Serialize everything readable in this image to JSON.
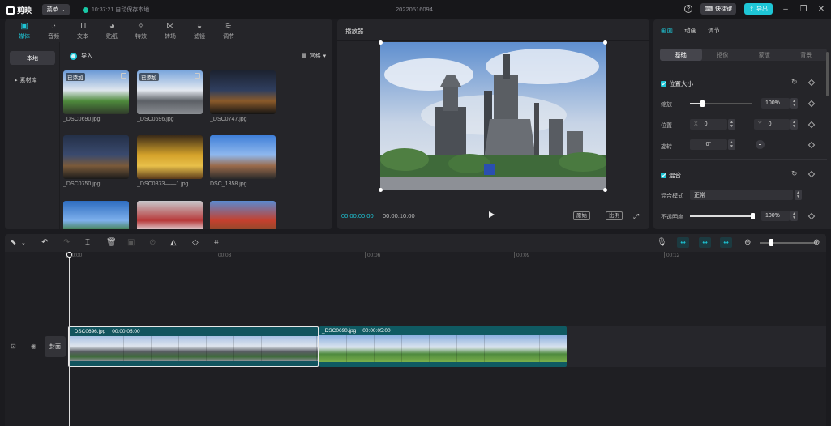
{
  "titlebar": {
    "app_name": "剪映",
    "menu_label": "菜单",
    "autosave_text": "10:37:21 自动保存本地",
    "project_title": "20220516094",
    "help_icon": "?",
    "shortcut_label": "快捷键",
    "export_label": "导出"
  },
  "media": {
    "tabs": [
      {
        "label": "媒体",
        "icon": "media-icon",
        "glyph": "▣",
        "active": true
      },
      {
        "label": "音频",
        "icon": "audio-icon",
        "glyph": "◔"
      },
      {
        "label": "文本",
        "icon": "text-icon",
        "glyph": "TI"
      },
      {
        "label": "贴纸",
        "icon": "sticker-icon",
        "glyph": "◕"
      },
      {
        "label": "特效",
        "icon": "effects-icon",
        "glyph": "✧"
      },
      {
        "label": "转场",
        "icon": "transition-icon",
        "glyph": "⋈"
      },
      {
        "label": "滤镜",
        "icon": "filter-icon",
        "glyph": "◒"
      },
      {
        "label": "调节",
        "icon": "adjust-icon",
        "glyph": "⚟"
      }
    ],
    "nav_local": "本地",
    "nav_library": "素材库",
    "import_label": "导入",
    "view_label": "宫格",
    "added_badge": "已添加",
    "items": [
      {
        "name": "_DSC0690.jpg",
        "added": true
      },
      {
        "name": "_DSC0696.jpg",
        "added": true
      },
      {
        "name": "_DSC0747.jpg",
        "added": false
      },
      {
        "name": "_DSC0750.jpg",
        "added": false
      },
      {
        "name": "_DSC0873——1.jpg",
        "added": false
      },
      {
        "name": "DSC_1358.jpg",
        "added": false
      },
      {
        "name": "",
        "added": false
      },
      {
        "name": "",
        "added": false
      },
      {
        "name": "",
        "added": false
      }
    ]
  },
  "player": {
    "title": "播放器",
    "current_time": "00:00:00:00",
    "total_time": "00:00:10:00",
    "btn_original": "原始",
    "btn_ratio": "比例"
  },
  "props": {
    "tabs": [
      "画面",
      "动画",
      "调节"
    ],
    "subtabs": [
      "基础",
      "抠像",
      "蒙版",
      "背景"
    ],
    "position_size": "位置大小",
    "scale_label": "缩放",
    "scale_value": "100%",
    "position_label": "位置",
    "x_label": "X",
    "x_value": "0",
    "y_label": "Y",
    "y_value": "0",
    "rotate_label": "旋转",
    "rotate_value": "0°",
    "blend_section": "混合",
    "blend_mode_label": "混合模式",
    "blend_mode_value": "正常",
    "opacity_label": "不透明度",
    "opacity_value": "100%",
    "scale_fraction": 0.2,
    "opacity_fraction": 1.0
  },
  "timeline": {
    "ruler": [
      "00:00",
      "00:03",
      "00:06",
      "00:09",
      "00:12"
    ],
    "cover_label": "封面",
    "clips": [
      {
        "name": "_DSC0696.jpg",
        "duration": "00:00:05:00",
        "selected": true
      },
      {
        "name": "_DSC0690.jpg",
        "duration": "00:00:05:00",
        "selected": false
      }
    ]
  },
  "colors": {
    "accent": "#1ec6d6",
    "panel": "#252529",
    "background": "#1b1b1f"
  }
}
